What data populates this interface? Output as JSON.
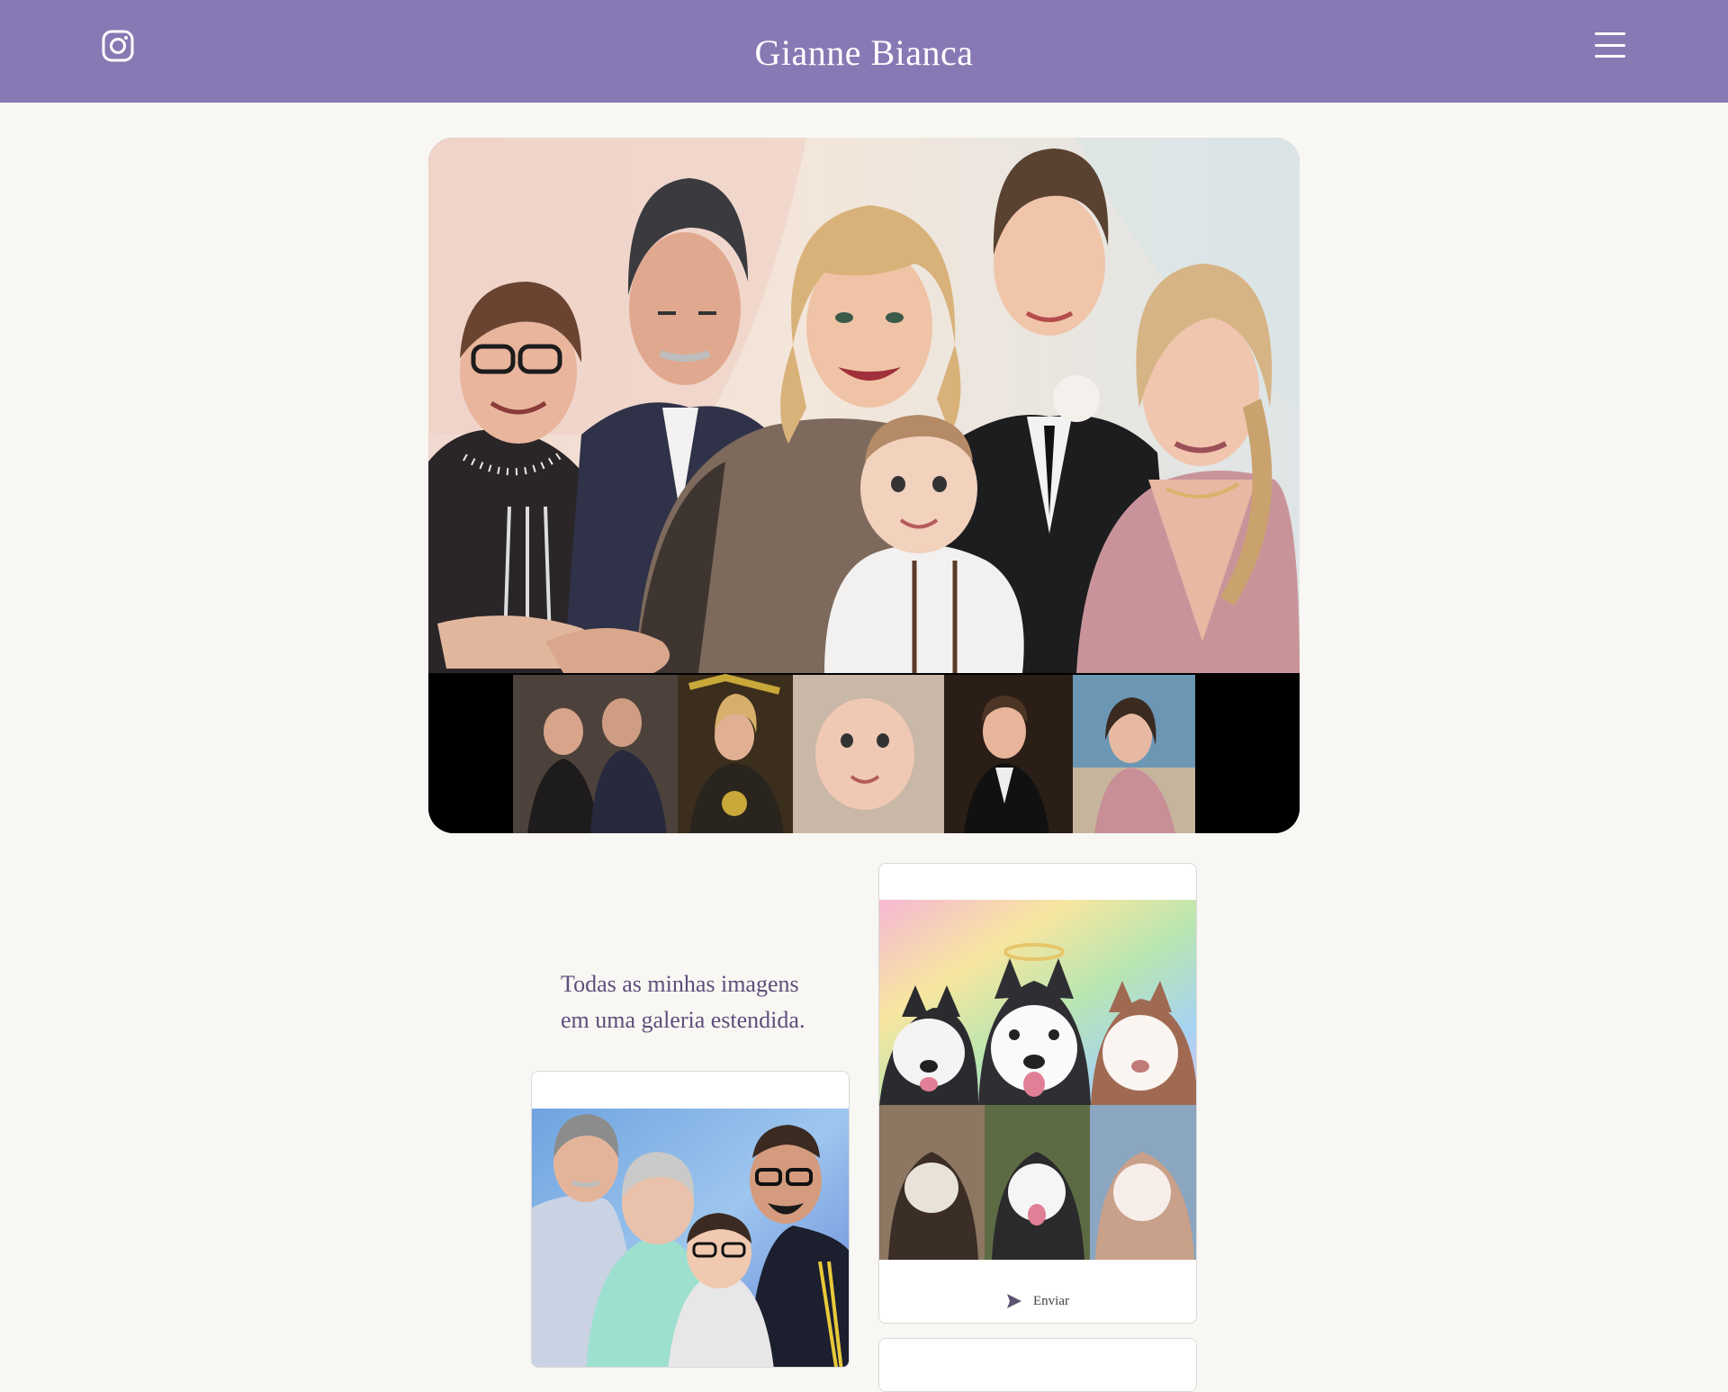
{
  "header": {
    "site_title": "Gianne Bianca",
    "instagram_icon": "instagram-icon",
    "menu_icon": "hamburger-menu-icon",
    "background_color": "#8878b3"
  },
  "hero": {
    "image": "family-caricature-with-reference-photos",
    "reference_photos_count": 5
  },
  "gallery": {
    "intro_line1": "Todas as minhas imagens",
    "intro_line2": "em uma galeria estendida.",
    "cards": [
      {
        "image": "husky-dogs-caricature",
        "action_label": "Enviar",
        "action_icon": "send-icon"
      },
      {
        "image": "family-portrait-caricature-blue-background"
      }
    ]
  },
  "colors": {
    "page_background": "#f8f7f3",
    "accent": "#8878b3",
    "intro_text": "#5c4f7c"
  }
}
